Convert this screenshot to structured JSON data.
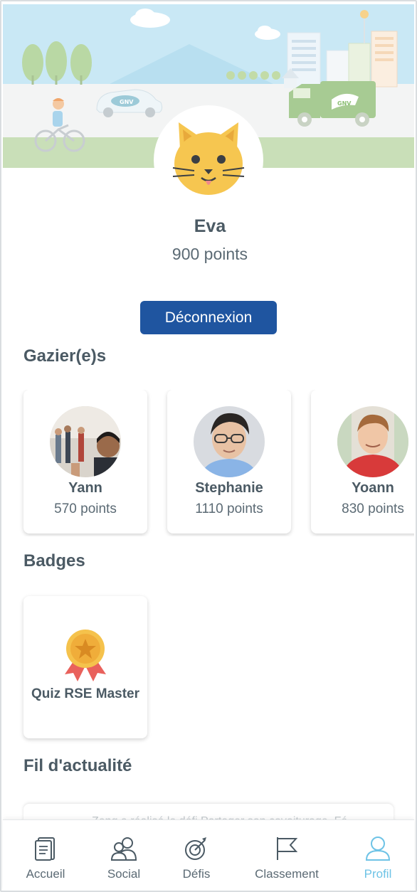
{
  "profile": {
    "name": "Eva",
    "points": "900 points",
    "logout_label": "Déconnexion"
  },
  "header": {
    "vehicle_tags": [
      "GNV",
      "GNV"
    ]
  },
  "sections": {
    "friends_title": "Gazier(e)s",
    "badges_title": "Badges",
    "news_title": "Fil d'actualité"
  },
  "friends": [
    {
      "name": "Yann",
      "points": "570 points"
    },
    {
      "name": "Stephanie",
      "points": "1110 points"
    },
    {
      "name": "Yoann",
      "points": "830 points"
    }
  ],
  "badges": [
    {
      "label": "Quiz RSE Master",
      "icon": "medal-star-icon"
    }
  ],
  "news": {
    "preview_text": "Zeng a réalisé le défi Partager son covoiturage. Fé"
  },
  "nav": [
    {
      "label": "Accueil",
      "icon": "document-icon",
      "active": false
    },
    {
      "label": "Social",
      "icon": "people-icon",
      "active": false
    },
    {
      "label": "Défis",
      "icon": "target-icon",
      "active": false
    },
    {
      "label": "Classement",
      "icon": "flag-icon",
      "active": false
    },
    {
      "label": "Profil",
      "icon": "user-icon",
      "active": true
    }
  ],
  "colors": {
    "primary_button": "#1f55a0",
    "active_nav": "#6ec3e6",
    "sky": "#c9e8f5",
    "grass": "#c9dfb8"
  }
}
